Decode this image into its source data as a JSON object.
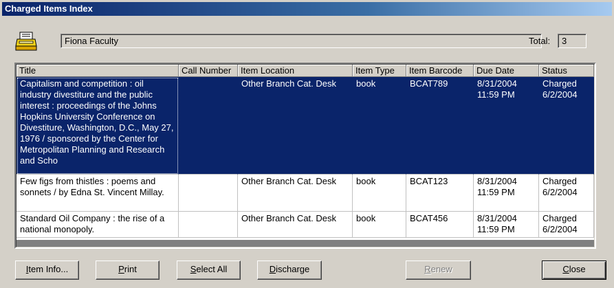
{
  "window": {
    "title": "Charged Items Index"
  },
  "patron": {
    "name": "Fiona Faculty",
    "icon": "printer-icon"
  },
  "total": {
    "label": "Total:",
    "value": "3"
  },
  "table": {
    "columns": [
      "Title",
      "Call Number",
      "Item Location",
      "Item Type",
      "Item Barcode",
      "Due Date",
      "Status"
    ],
    "rows": [
      {
        "title": "Capitalism and competition : oil industry divestiture and the public interest : proceedings of the Johns Hopkins University Conference on Divestiture, Washington, D.C., May 27, 1976 / sponsored by the Center for Metropolitan Planning and Research and Scho",
        "call_number": "",
        "location": "Other Branch Cat. Desk",
        "type": "book",
        "barcode": "BCAT789",
        "due_date": "8/31/2004 11:59 PM",
        "status": "Charged 6/2/2004",
        "selected": true
      },
      {
        "title": "Few figs from thistles : poems and sonnets / by Edna St. Vincent Millay.",
        "call_number": "",
        "location": "Other Branch Cat. Desk",
        "type": "book",
        "barcode": "BCAT123",
        "due_date": "8/31/2004 11:59 PM",
        "status": "Charged 6/2/2004",
        "selected": false
      },
      {
        "title": "Standard Oil Company : the rise of a national monopoly.",
        "call_number": "",
        "location": "Other Branch Cat. Desk",
        "type": "book",
        "barcode": "BCAT456",
        "due_date": "8/31/2004 11:59 PM",
        "status": "Charged 6/2/2004",
        "selected": false
      }
    ]
  },
  "buttons": {
    "item_info": {
      "prefix": "I",
      "rest": "tem Info..."
    },
    "print": {
      "prefix": "P",
      "rest": "rint"
    },
    "select_all": {
      "prefix": "S",
      "rest": "elect All"
    },
    "discharge": {
      "prefix": "D",
      "rest": "ischarge"
    },
    "renew": {
      "prefix": "R",
      "rest": "enew"
    },
    "close": {
      "prefix": "C",
      "rest": "lose"
    }
  }
}
